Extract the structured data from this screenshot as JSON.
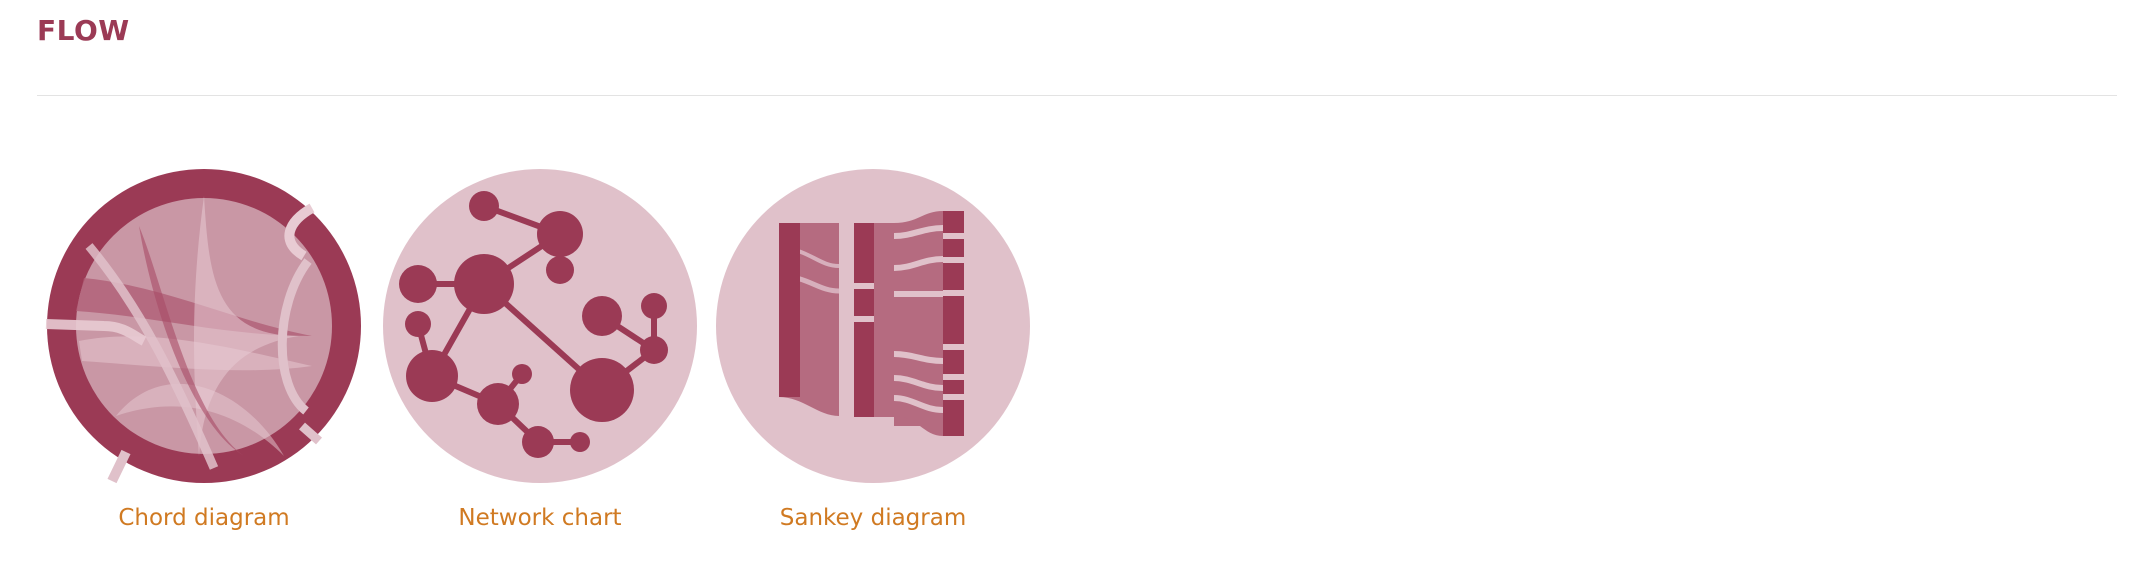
{
  "section": {
    "title": "FLOW"
  },
  "items": [
    {
      "label": "Chord diagram",
      "icon": "chord-diagram-icon"
    },
    {
      "label": "Network chart",
      "icon": "network-chart-icon"
    },
    {
      "label": "Sankey diagram",
      "icon": "sankey-diagram-icon"
    }
  ],
  "colors": {
    "title": "#9b3a55",
    "accent": "#9b3a55",
    "icon_background": "#e0c1ca",
    "link": "#d07a22",
    "divider": "#e3e3e3"
  }
}
